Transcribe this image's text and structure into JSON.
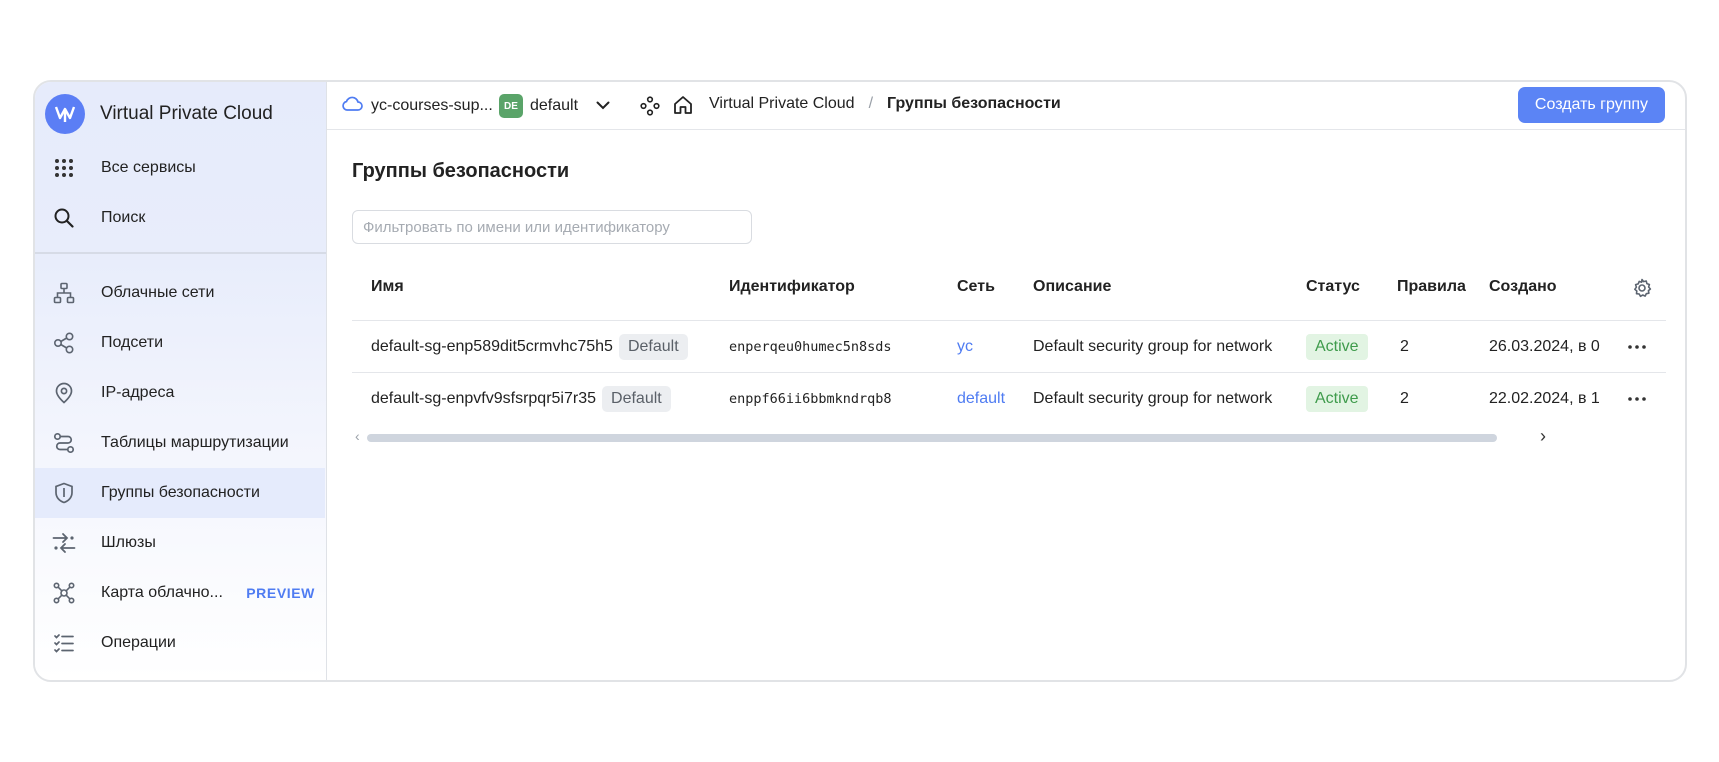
{
  "app": {
    "title": "Virtual Private Cloud"
  },
  "sidebar": {
    "top_items": [
      {
        "label": "Все сервисы",
        "icon": "grid-icon"
      },
      {
        "label": "Поиск",
        "icon": "search-icon"
      }
    ],
    "items": [
      {
        "label": "Облачные сети",
        "icon": "network-icon"
      },
      {
        "label": "Подсети",
        "icon": "subnet-icon"
      },
      {
        "label": "IP-адреса",
        "icon": "location-pin-icon"
      },
      {
        "label": "Таблицы маршрутизации",
        "icon": "route-icon"
      },
      {
        "label": "Группы безопасности",
        "icon": "shield-icon",
        "active": true
      },
      {
        "label": "Шлюзы",
        "icon": "gateway-arrows-icon"
      },
      {
        "label": "Карта облачно...",
        "icon": "graph-icon",
        "badge": "PREVIEW"
      },
      {
        "label": "Операции",
        "icon": "checklist-icon"
      }
    ]
  },
  "topbar": {
    "cloud": "yc-courses-sup...",
    "folder_badge": "DE",
    "folder": "default",
    "breadcrumb": {
      "service": "Virtual Private Cloud",
      "separator": "/",
      "current": "Группы безопасности"
    },
    "create_button": "Создать группу"
  },
  "page": {
    "title": "Группы безопасности",
    "filter_placeholder": "Фильтровать по имени или идентификатору"
  },
  "table": {
    "columns": [
      "Имя",
      "Идентификатор",
      "Сеть",
      "Описание",
      "Статус",
      "Правила",
      "Создано"
    ],
    "rows": [
      {
        "name": "default-sg-enp589dit5crmvhc75h5",
        "tag": "Default",
        "id": "enperqeu0humec5n8sds",
        "network": "yc",
        "description": "Default security group for network",
        "status": "Active",
        "rules": "2",
        "created": "26.03.2024, в 0"
      },
      {
        "name": "default-sg-enpvfv9sfsrpqr5i7r35",
        "tag": "Default",
        "id": "enppf66ii6bbmkndrqb8",
        "network": "default",
        "description": "Default security group for network",
        "status": "Active",
        "rules": "2",
        "created": "22.02.2024, в 1"
      }
    ]
  },
  "colors": {
    "accent": "#5b84f5",
    "active_bg": "#e5ebfc",
    "status_green": "#3f9b4c",
    "folder_badge": "#5aa469"
  }
}
